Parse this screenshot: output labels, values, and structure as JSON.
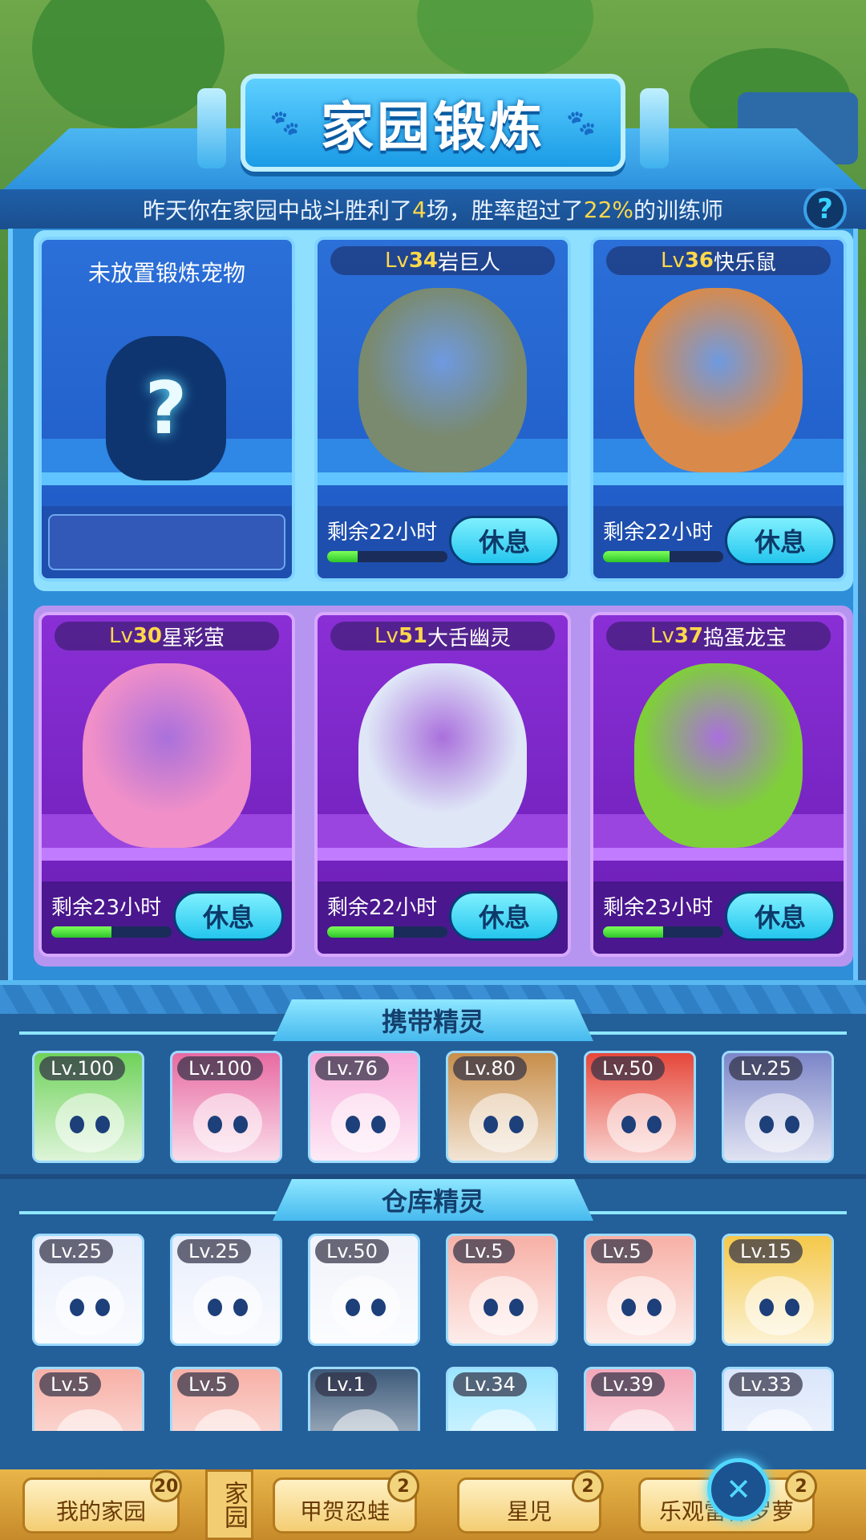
{
  "header": {
    "title": "家园锻炼",
    "info": {
      "p1": "昨天你在家园中战斗胜利了",
      "wins": "4",
      "p2": "场，胜率超过了",
      "rate": "22%",
      "p3": "的训练师"
    },
    "help": "?"
  },
  "slots": [
    {
      "empty": true,
      "empty_label": "未放置锻炼宠物",
      "mark": "?"
    },
    {
      "lv_prefix": "Lv",
      "level": "34",
      "name": "岩巨人",
      "remain": "剩余22小时",
      "progress": 0.25,
      "rest": "休息",
      "color": "#7a8a6e"
    },
    {
      "lv_prefix": "Lv",
      "level": "36",
      "name": "快乐鼠",
      "remain": "剩余22小时",
      "progress": 0.55,
      "rest": "休息",
      "color": "#d98a4a"
    },
    {
      "lv_prefix": "Lv",
      "level": "30",
      "name": "星彩萤",
      "remain": "剩余23小时",
      "progress": 0.5,
      "rest": "休息",
      "color": "#f08fc8"
    },
    {
      "lv_prefix": "Lv",
      "level": "51",
      "name": "大舌幽灵",
      "remain": "剩余22小时",
      "progress": 0.55,
      "rest": "休息",
      "color": "#dfe7f7"
    },
    {
      "lv_prefix": "Lv",
      "level": "37",
      "name": "捣蛋龙宝",
      "remain": "剩余23小时",
      "progress": 0.5,
      "rest": "休息",
      "color": "#7fcf3a"
    }
  ],
  "carry": {
    "title": "携带精灵",
    "pets": [
      {
        "lv": "Lv.100",
        "color": "#6fd25a"
      },
      {
        "lv": "Lv.100",
        "color": "#e86aa2"
      },
      {
        "lv": "Lv.76",
        "color": "#f7a8d8"
      },
      {
        "lv": "Lv.80",
        "color": "#c88e4a"
      },
      {
        "lv": "Lv.50",
        "color": "#e6473a"
      },
      {
        "lv": "Lv.25",
        "color": "#7c86c8"
      }
    ]
  },
  "storage": {
    "title": "仓库精灵",
    "row1": [
      {
        "lv": "Lv.25",
        "color": "#e8eefc"
      },
      {
        "lv": "Lv.25",
        "color": "#e8eefc"
      },
      {
        "lv": "Lv.50",
        "color": "#f1f3fb"
      },
      {
        "lv": "Lv.5",
        "color": "#f7b0a6"
      },
      {
        "lv": "Lv.5",
        "color": "#f7b0a6"
      },
      {
        "lv": "Lv.15",
        "color": "#f4c84a"
      }
    ],
    "row2": [
      {
        "lv": "Lv.5",
        "color": "#f7b0a6"
      },
      {
        "lv": "Lv.5",
        "color": "#f7b0a6"
      },
      {
        "lv": "Lv.1",
        "color": "#3d5a7a"
      },
      {
        "lv": "Lv.34",
        "color": "#9be6ff"
      },
      {
        "lv": "Lv.39",
        "color": "#f4a6b8"
      },
      {
        "lv": "Lv.33",
        "color": "#dbe6fb"
      }
    ]
  },
  "dock": {
    "my_home": "我的家园",
    "my_home_badge": "20",
    "vertical_label": "家园",
    "item2": "甲贺忍蛙",
    "item2_badge": "2",
    "item3": "星児",
    "item3_badge": "2",
    "item4": "乐观雷神罗萝",
    "item4_badge": "2",
    "close": "✕"
  }
}
